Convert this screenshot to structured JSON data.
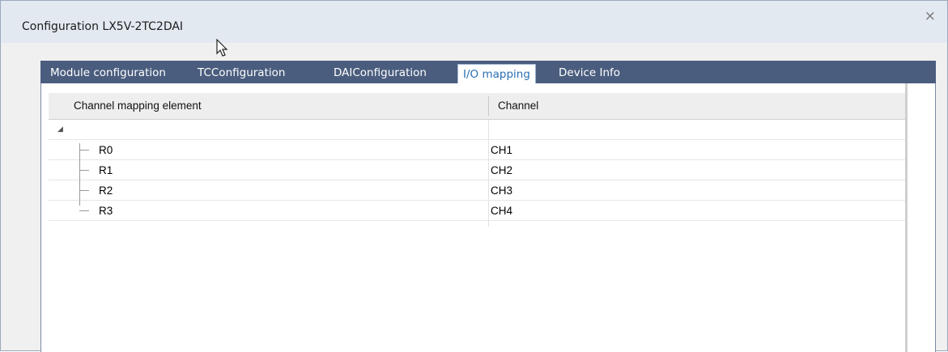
{
  "window": {
    "title": "Configuration LX5V-2TC2DAI",
    "close_glyph": "×"
  },
  "tabs": [
    {
      "label": "Module configuration",
      "active": false
    },
    {
      "label": "TCConfiguration",
      "active": false
    },
    {
      "label": "DAIConfiguration",
      "active": false
    },
    {
      "label": "I/O mapping",
      "active": true
    },
    {
      "label": "Device Info",
      "active": false
    }
  ],
  "table": {
    "columns": [
      "Channel mapping element",
      "Channel"
    ],
    "root_expander": "◢",
    "rows": [
      {
        "element": "R0",
        "channel": "CH1"
      },
      {
        "element": "R1",
        "channel": "CH2"
      },
      {
        "element": "R2",
        "channel": "CH3"
      },
      {
        "element": "R3",
        "channel": "CH4"
      }
    ]
  },
  "colors": {
    "tabstrip": "#4a5d7e",
    "active_tab_text": "#2a6fb3",
    "titlebar": "#e3e9f1"
  }
}
